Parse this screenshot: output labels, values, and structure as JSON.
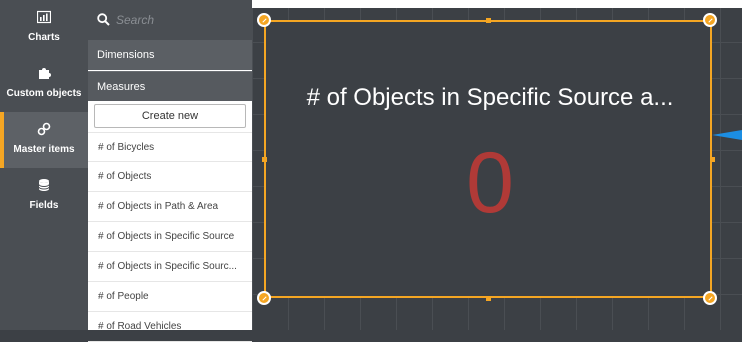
{
  "rail": {
    "items": [
      {
        "label": "Charts",
        "icon": "bar-chart-icon"
      },
      {
        "label": "Custom objects",
        "icon": "puzzle-icon"
      },
      {
        "label": "Master items",
        "icon": "link-icon",
        "active": true
      },
      {
        "label": "Fields",
        "icon": "database-icon"
      }
    ]
  },
  "search": {
    "placeholder": "Search"
  },
  "sections": {
    "dimensions_label": "Dimensions",
    "measures_label": "Measures"
  },
  "create_button_label": "Create new",
  "measures": [
    "# of Bicycles",
    "# of Objects",
    "# of Objects in Path & Area",
    "# of Objects in Specific Source",
    "# of Objects in Specific Sourc...",
    "# of People",
    "# of Road Vehicles"
  ],
  "kpi": {
    "title": "# of Objects in Specific Source a...",
    "value": "0"
  },
  "colors": {
    "accent": "#f5a623",
    "kpi_value": "#b03a37",
    "drop_indicator": "#1c8ee3",
    "rail_bg": "#4a4e53",
    "canvas_bg": "#3c4045"
  }
}
